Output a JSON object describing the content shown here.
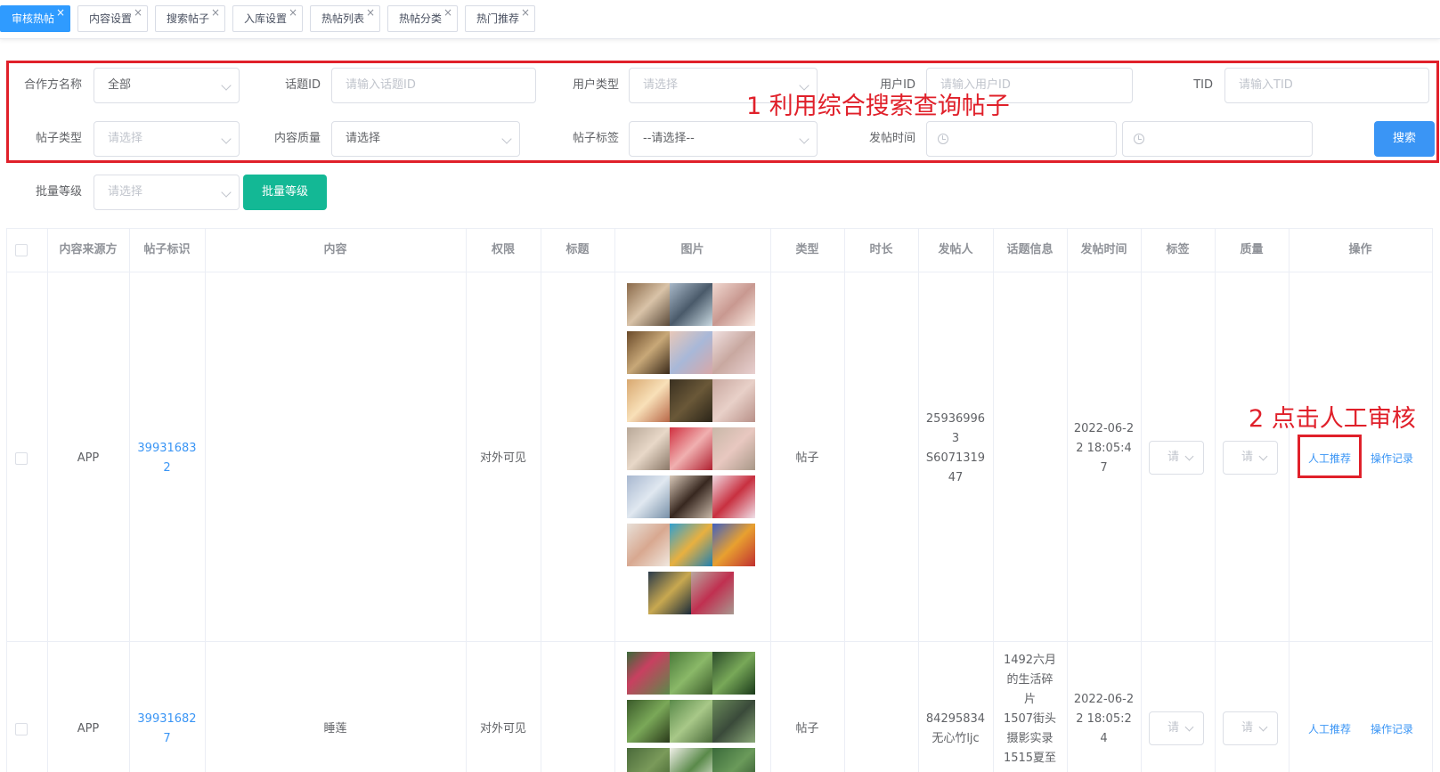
{
  "tabs": [
    {
      "label": "审核热帖",
      "active": true
    },
    {
      "label": "内容设置",
      "active": false
    },
    {
      "label": "搜索帖子",
      "active": false
    },
    {
      "label": "入库设置",
      "active": false
    },
    {
      "label": "热帖列表",
      "active": false
    },
    {
      "label": "热帖分类",
      "active": false
    },
    {
      "label": "热门推荐",
      "active": false
    }
  ],
  "filters": {
    "partner_label": "合作方名称",
    "partner_value": "全部",
    "topic_label": "话题ID",
    "topic_placeholder": "请输入话题ID",
    "usertype_label": "用户类型",
    "usertype_placeholder": "请选择",
    "userid_label": "用户ID",
    "userid_placeholder": "请输入用户ID",
    "tid_label": "TID",
    "tid_placeholder": "请输入TID",
    "posttype_label": "帖子类型",
    "posttype_placeholder": "请选择",
    "quality_label": "内容质量",
    "quality_value": "请选择",
    "tag_label": "帖子标签",
    "tag_value": "--请选择--",
    "time_label": "发帖时间",
    "search_button": "搜索",
    "batch_label": "批量等级",
    "batch_placeholder": "请选择",
    "batch_button": "批量等级"
  },
  "annotations": {
    "step1": "1  利用综合搜索查询帖子",
    "step2": "2  点击人工审核"
  },
  "table": {
    "headers": [
      "内容来源方",
      "帖子标识",
      "内容",
      "权限",
      "标题",
      "图片",
      "类型",
      "时长",
      "发帖人",
      "话题信息",
      "发帖时间",
      "标签",
      "质量",
      "操作"
    ],
    "rows": [
      {
        "source": "APP",
        "id_l1": "39931683",
        "id_l2": "2",
        "content": "",
        "permission": "对外可见",
        "type": "帖子",
        "poster_l1": "25936996",
        "poster_l2": "3",
        "poster_l3": "S6071319",
        "poster_l4": "47",
        "topic_l1": "",
        "topic_l2": "",
        "topic_l3": "",
        "topic_l4": "",
        "topic_l5": "",
        "time_l1": "2022-06-2",
        "time_l2": "2 18:05:4",
        "time_l3": "7",
        "tag_sel": "请",
        "quality_sel": "请",
        "action_review": "人工推荐",
        "action_log": "操作记录"
      },
      {
        "source": "APP",
        "id_l1": "39931682",
        "id_l2": "7",
        "content": "睡莲",
        "permission": "对外可见",
        "type": "帖子",
        "poster_l1": "84295834",
        "poster_l2": "无心竹ljc",
        "poster_l3": "",
        "poster_l4": "",
        "topic_l1": "1492六月",
        "topic_l2": "的生活碎",
        "topic_l3": "片",
        "topic_l4": "1507街头",
        "topic_l5": "摄影实录",
        "topic_l6": "1515夏至",
        "time_l1": "2022-06-2",
        "time_l2": "2 18:05:2",
        "time_l3": "4",
        "tag_sel": "请",
        "quality_sel": "请",
        "action_review": "人工推荐",
        "action_log": "操作记录"
      }
    ]
  },
  "colors": {
    "primary": "#3a95f5",
    "green": "#13b895",
    "annotation_red": "#e0202a"
  }
}
